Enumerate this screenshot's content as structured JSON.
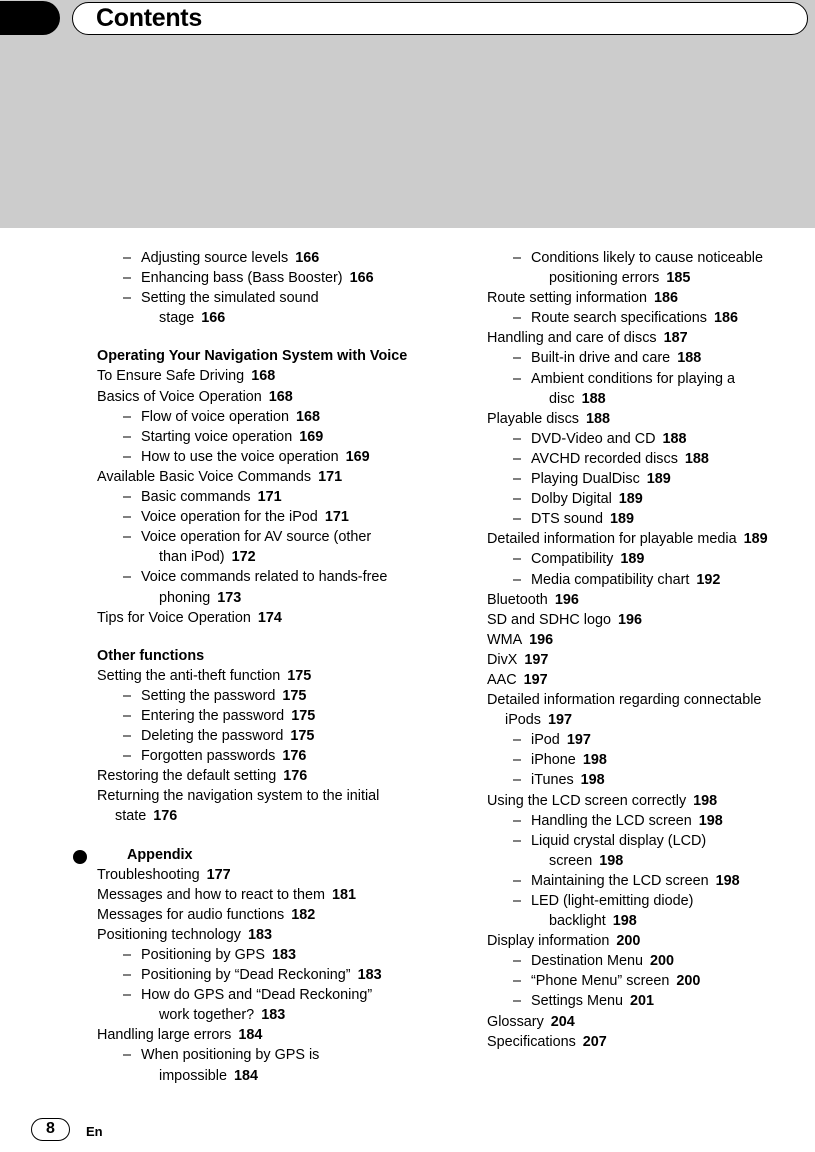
{
  "header": {
    "title": "Contents",
    "tab_icon": "black-tab-marker"
  },
  "footer": {
    "page_number": "8",
    "language_code": "En"
  },
  "columns": {
    "left": [
      {
        "level": 2,
        "text": "Adjusting source levels",
        "page": "166"
      },
      {
        "level": 2,
        "text": "Enhancing bass (Bass Booster)",
        "page": "166"
      },
      {
        "level": 2,
        "text": "Setting the simulated sound",
        "cont": "stage",
        "page": "166"
      },
      {
        "level": 0,
        "text": "Operating Your Navigation System with Voice"
      },
      {
        "level": 1,
        "text": "To Ensure Safe Driving",
        "page": "168"
      },
      {
        "level": 1,
        "text": "Basics of Voice Operation",
        "page": "168"
      },
      {
        "level": 2,
        "text": "Flow of voice operation",
        "page": "168"
      },
      {
        "level": 2,
        "text": "Starting voice operation",
        "page": "169"
      },
      {
        "level": 2,
        "text": "How to use the voice operation",
        "page": "169"
      },
      {
        "level": 1,
        "text": "Available Basic Voice Commands",
        "page": "171"
      },
      {
        "level": 2,
        "text": "Basic commands",
        "page": "171"
      },
      {
        "level": 2,
        "text": "Voice operation for the iPod",
        "page": "171"
      },
      {
        "level": 2,
        "text": "Voice operation for AV source (other",
        "cont": "than iPod)",
        "page": "172"
      },
      {
        "level": 2,
        "text": "Voice commands related to hands-free",
        "cont": "phoning",
        "page": "173"
      },
      {
        "level": 1,
        "text": "Tips for Voice Operation",
        "page": "174"
      },
      {
        "level": 0,
        "text": "Other functions"
      },
      {
        "level": 1,
        "text": "Setting the anti-theft function",
        "page": "175"
      },
      {
        "level": 2,
        "text": "Setting the password",
        "page": "175"
      },
      {
        "level": 2,
        "text": "Entering the password",
        "page": "175"
      },
      {
        "level": 2,
        "text": "Deleting the password",
        "page": "175"
      },
      {
        "level": 2,
        "text": "Forgotten passwords",
        "page": "176"
      },
      {
        "level": 1,
        "text": "Restoring the default setting",
        "page": "176"
      },
      {
        "level": 1,
        "text": "Returning the navigation system to the initial",
        "cont": "state",
        "page": "176"
      },
      {
        "level": -1,
        "text": "Appendix"
      },
      {
        "level": 1,
        "text": "Troubleshooting",
        "page": "177"
      },
      {
        "level": 1,
        "text": "Messages and how to react to them",
        "page": "181"
      },
      {
        "level": 1,
        "text": "Messages for audio functions",
        "page": "182"
      },
      {
        "level": 1,
        "text": "Positioning technology",
        "page": "183"
      },
      {
        "level": 2,
        "text": "Positioning by GPS",
        "page": "183"
      },
      {
        "level": 2,
        "text": "Positioning by “Dead Reckoning”",
        "page": "183"
      },
      {
        "level": 2,
        "text": "How do GPS and “Dead Reckoning”",
        "cont": "work together?",
        "page": "183"
      },
      {
        "level": 1,
        "text": "Handling large errors",
        "page": "184"
      },
      {
        "level": 2,
        "text": "When positioning by GPS is",
        "cont": "impossible",
        "page": "184"
      }
    ],
    "right": [
      {
        "level": 2,
        "text": "Conditions likely to cause noticeable",
        "cont": "positioning errors",
        "page": "185"
      },
      {
        "level": 1,
        "text": "Route setting information",
        "page": "186"
      },
      {
        "level": 2,
        "text": "Route search specifications",
        "page": "186"
      },
      {
        "level": 1,
        "text": "Handling and care of discs",
        "page": "187"
      },
      {
        "level": 2,
        "text": "Built-in drive and care",
        "page": "188"
      },
      {
        "level": 2,
        "text": "Ambient conditions for playing a",
        "cont": "disc",
        "page": "188"
      },
      {
        "level": 1,
        "text": "Playable discs",
        "page": "188"
      },
      {
        "level": 2,
        "text": "DVD-Video and CD",
        "page": "188"
      },
      {
        "level": 2,
        "text": "AVCHD recorded discs",
        "page": "188"
      },
      {
        "level": 2,
        "text": "Playing DualDisc",
        "page": "189"
      },
      {
        "level": 2,
        "text": "Dolby Digital",
        "page": "189"
      },
      {
        "level": 2,
        "text": "DTS sound",
        "page": "189"
      },
      {
        "level": 1,
        "text": "Detailed information for playable media",
        "page": "189"
      },
      {
        "level": 2,
        "text": "Compatibility",
        "page": "189"
      },
      {
        "level": 2,
        "text": "Media compatibility chart",
        "page": "192"
      },
      {
        "level": 1,
        "text": "Bluetooth",
        "page": "196"
      },
      {
        "level": 1,
        "text": "SD and SDHC logo",
        "page": "196"
      },
      {
        "level": 1,
        "text": "WMA",
        "page": "196"
      },
      {
        "level": 1,
        "text": "DivX",
        "page": "197"
      },
      {
        "level": 1,
        "text": "AAC",
        "page": "197"
      },
      {
        "level": 1,
        "text": "Detailed information regarding connectable",
        "cont": "iPods",
        "page": "197"
      },
      {
        "level": 2,
        "text": "iPod",
        "page": "197"
      },
      {
        "level": 2,
        "text": "iPhone",
        "page": "198"
      },
      {
        "level": 2,
        "text": "iTunes",
        "page": "198"
      },
      {
        "level": 1,
        "text": "Using the LCD screen correctly",
        "page": "198"
      },
      {
        "level": 2,
        "text": "Handling the LCD screen",
        "page": "198"
      },
      {
        "level": 2,
        "text": "Liquid crystal display (LCD)",
        "cont": "screen",
        "page": "198"
      },
      {
        "level": 2,
        "text": "Maintaining the LCD screen",
        "page": "198"
      },
      {
        "level": 2,
        "text": "LED (light-emitting diode)",
        "cont": "backlight",
        "page": "198"
      },
      {
        "level": 1,
        "text": "Display information",
        "page": "200"
      },
      {
        "level": 2,
        "text": "Destination Menu",
        "page": "200"
      },
      {
        "level": 2,
        "text": "“Phone Menu” screen",
        "page": "200"
      },
      {
        "level": 2,
        "text": "Settings Menu",
        "page": "201"
      },
      {
        "level": 1,
        "text": "Glossary",
        "page": "204"
      },
      {
        "level": 1,
        "text": "Specifications",
        "page": "207"
      }
    ]
  },
  "colors": {
    "header_band": "#cccccc",
    "text": "#000000",
    "page_background": "#ffffff"
  }
}
